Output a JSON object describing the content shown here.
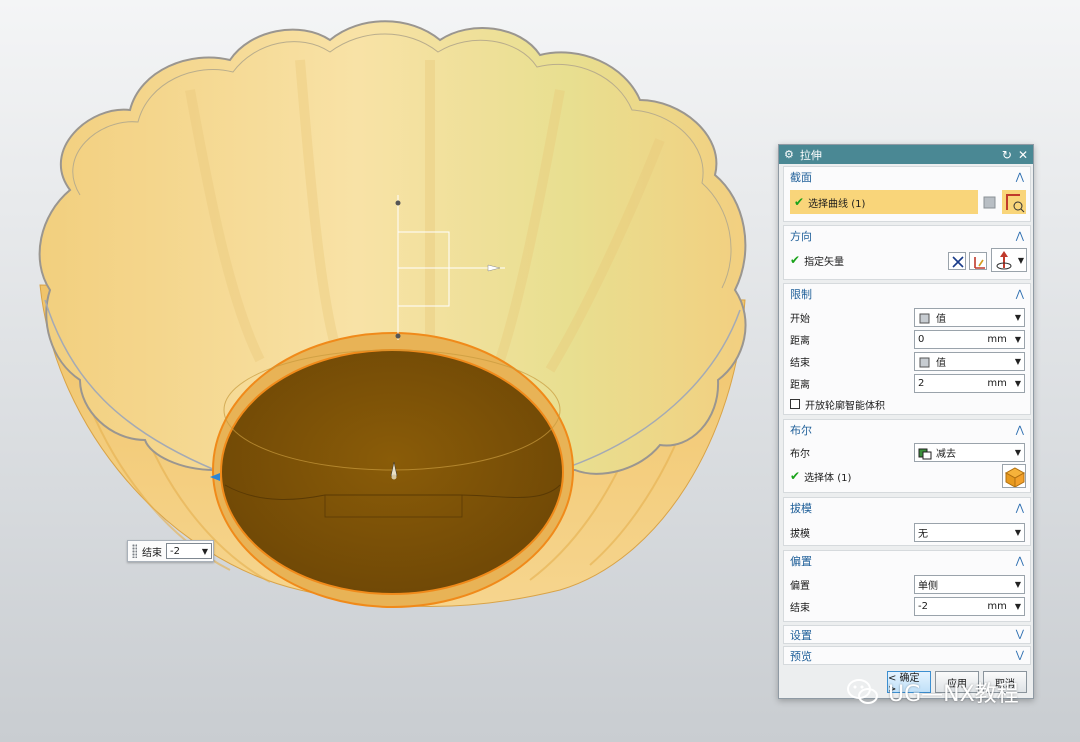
{
  "floating_input": {
    "label": "结束",
    "value": "-2"
  },
  "dialog": {
    "title": "拉伸",
    "section": {
      "header": "截面",
      "select_curve": "选择曲线 (1)"
    },
    "direction": {
      "header": "方向",
      "specify_vector": "指定矢量"
    },
    "limits": {
      "header": "限制",
      "start_label": "开始",
      "start_value": "值",
      "distance1_label": "距离",
      "distance1_value": "0",
      "end_label": "结束",
      "end_value": "值",
      "distance2_label": "距离",
      "distance2_value": "2",
      "unit": "mm",
      "open_profile_label": "开放轮廓智能体积"
    },
    "boolean": {
      "header": "布尔",
      "boolean_label": "布尔",
      "boolean_value": "减去",
      "select_body": "选择体 (1)"
    },
    "draft": {
      "header": "拔模",
      "draft_label": "拔模",
      "draft_value": "无"
    },
    "offset": {
      "header": "偏置",
      "offset_label": "偏置",
      "offset_value": "单侧",
      "end_label": "结束",
      "end_value": "-2",
      "unit": "mm"
    },
    "settings": {
      "header": "设置"
    },
    "preview": {
      "header": "预览"
    },
    "buttons": {
      "ok": "< 确定 >",
      "apply": "应用",
      "cancel": "取消"
    }
  },
  "watermark": {
    "text": "UG—NX教程"
  },
  "colors": {
    "bowl_light": "#f6d98e",
    "bowl_mid": "#eab85a",
    "bottom_fill": "#7a5106",
    "edge_orange": "#f08a1a",
    "title_bar": "#4a8894",
    "group_header_text": "#1f5f99",
    "selected_row": "#f9d57a"
  }
}
